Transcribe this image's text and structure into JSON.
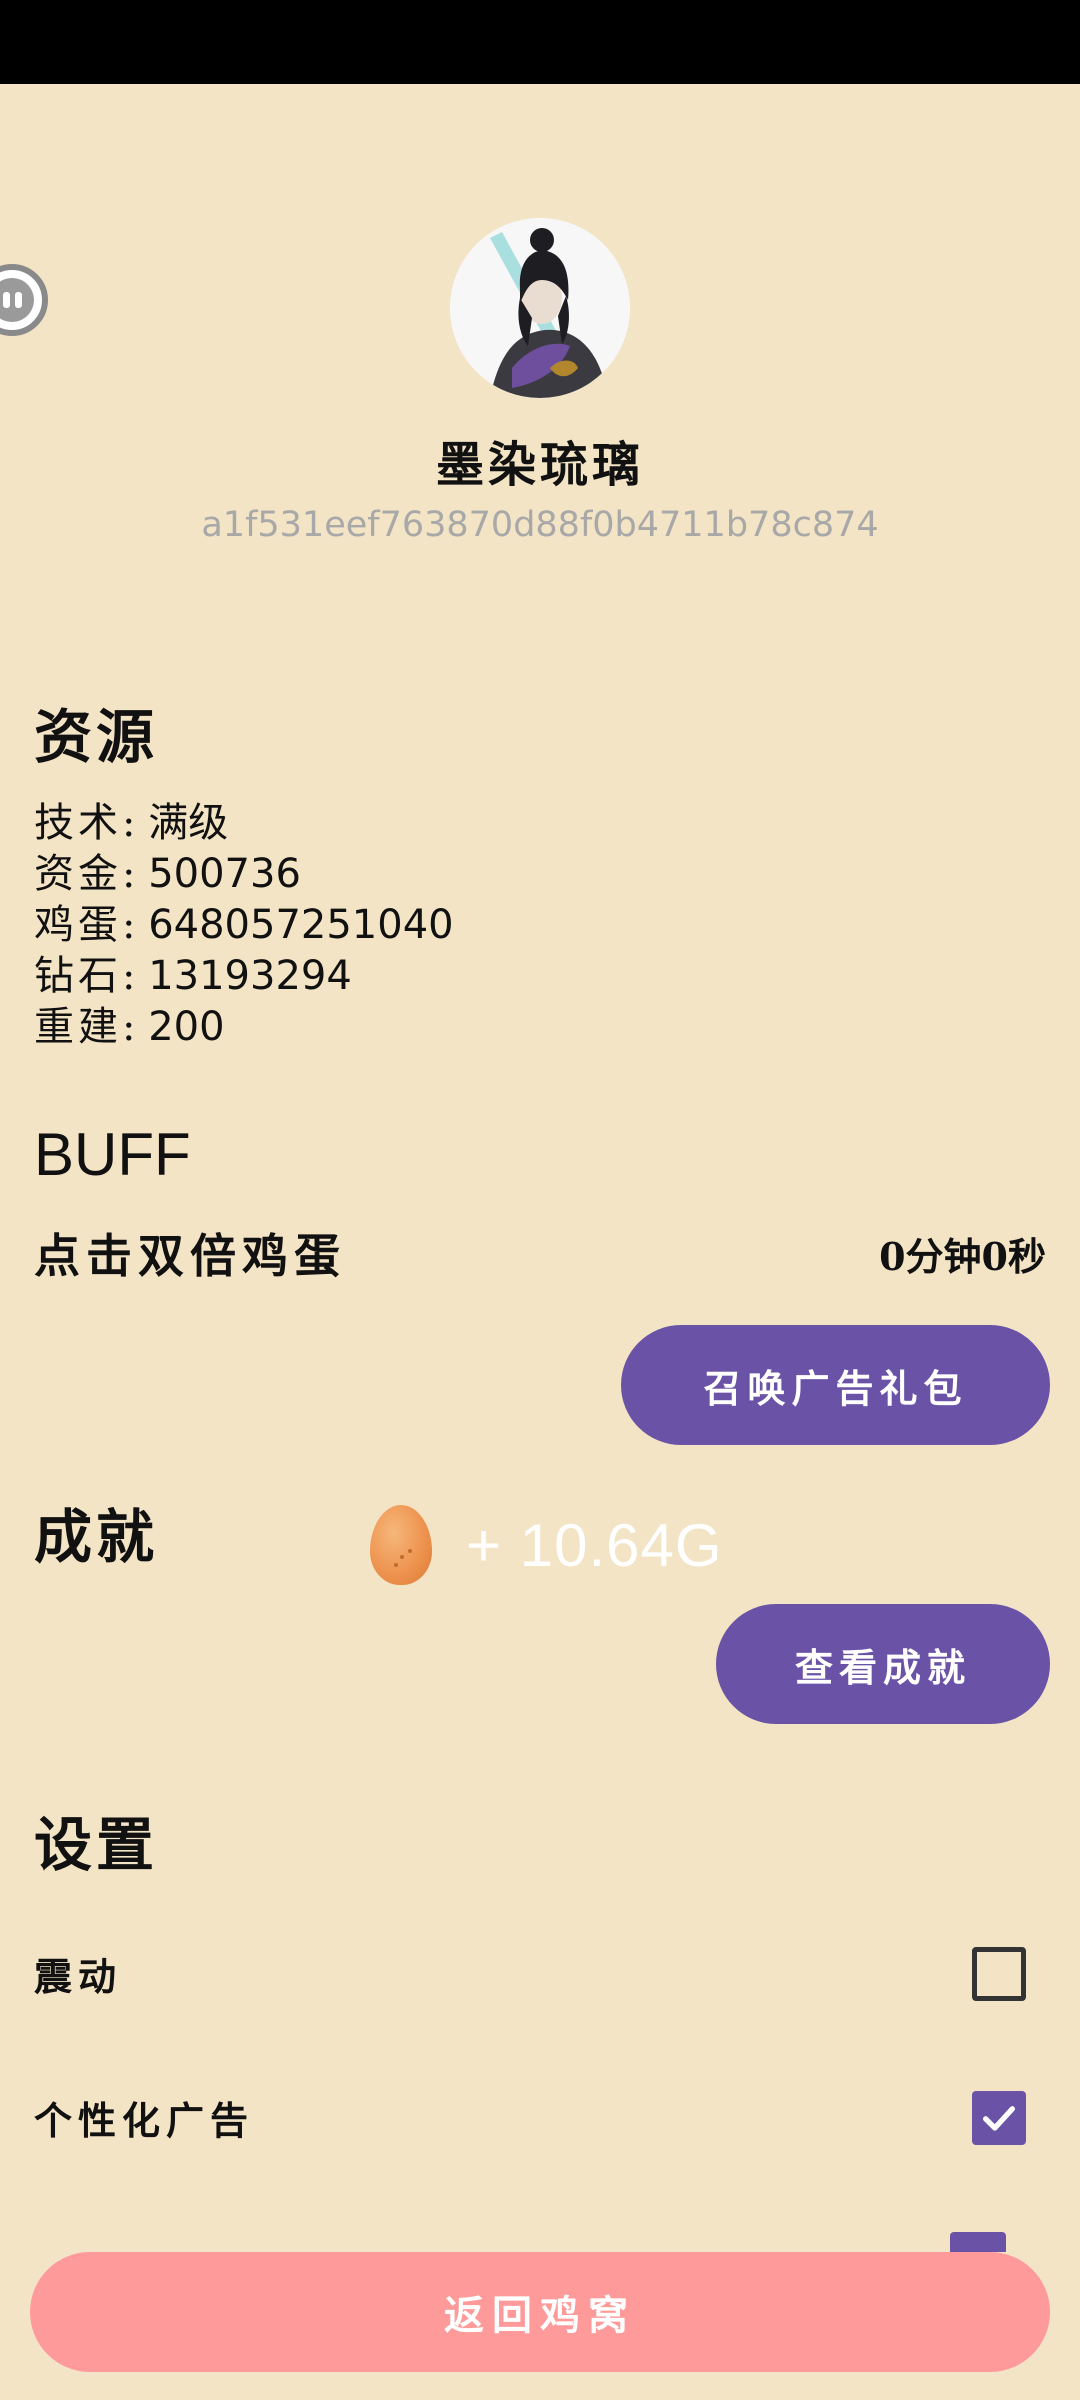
{
  "profile": {
    "name": "墨染琉璃",
    "id": "a1f531eef763870d88f0b4711b78c874"
  },
  "resources": {
    "title": "资源",
    "items": [
      {
        "label": "技术",
        "value": "满级"
      },
      {
        "label": "资金",
        "value": "500736"
      },
      {
        "label": "鸡蛋",
        "value": "648057251040"
      },
      {
        "label": "钻石",
        "value": "13193294"
      },
      {
        "label": "重建",
        "value": "200"
      }
    ]
  },
  "buff": {
    "title": "BUFF",
    "label": "点击双倍鸡蛋",
    "timer": "0分钟0秒",
    "button_label": "召唤广告礼包"
  },
  "achievements": {
    "title": "成就",
    "button_label": "查看成就"
  },
  "egg_toast": {
    "text": "+ 10.64G"
  },
  "settings": {
    "title": "设置",
    "items": [
      {
        "label": "震动",
        "checked": false
      },
      {
        "label": "个性化广告",
        "checked": true
      }
    ]
  },
  "footer": {
    "back_label": "返回鸡窝"
  },
  "colors": {
    "background": "#f4e4c6",
    "accent": "#6a52a6",
    "back_button": "#fe9a9a"
  }
}
